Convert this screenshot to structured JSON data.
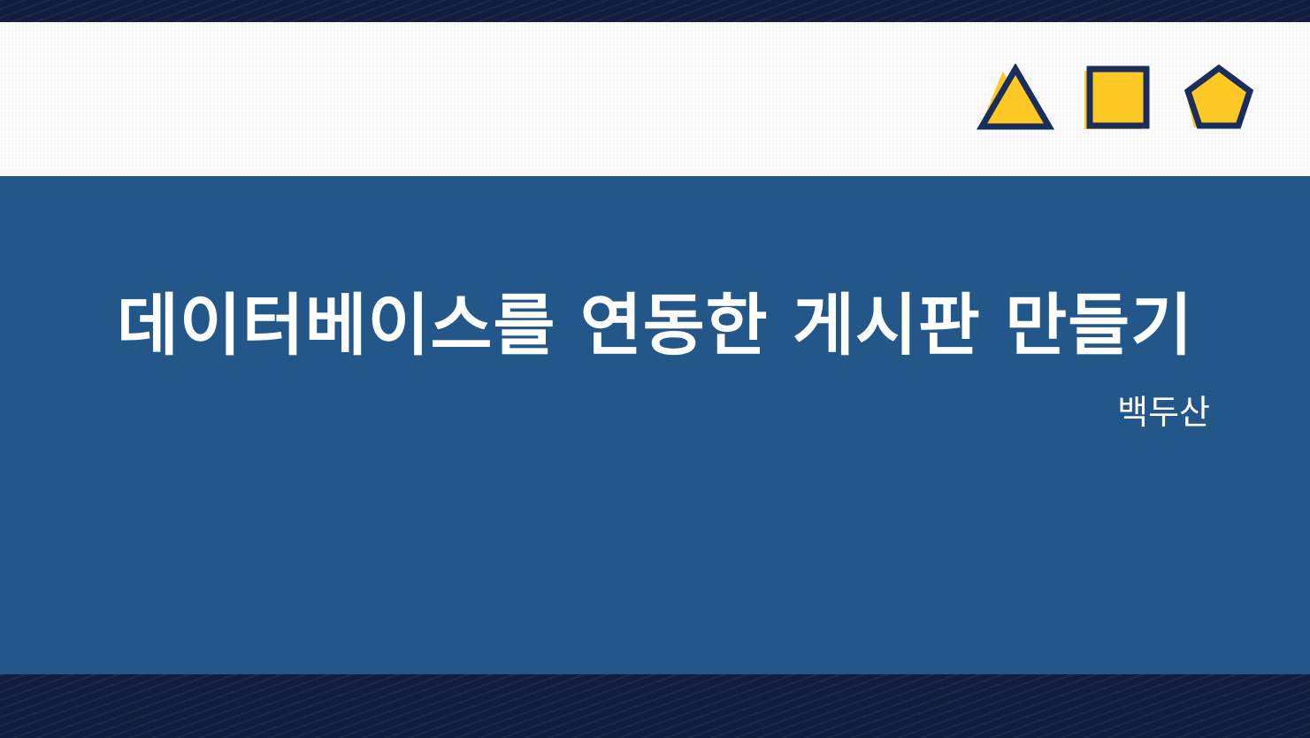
{
  "slide": {
    "title": "데이터베이스를 연동한 게시판 만들기",
    "author": "백두산"
  },
  "icons": [
    "triangle-icon",
    "square-icon",
    "pentagon-icon"
  ],
  "colors": {
    "dark_navy": "#111d3f",
    "panel_blue": "#235789",
    "header_bg": "#fbfbfb",
    "accent_yellow": "#ffc925",
    "outline_navy": "#1a2e5c",
    "text": "#ffffff"
  }
}
